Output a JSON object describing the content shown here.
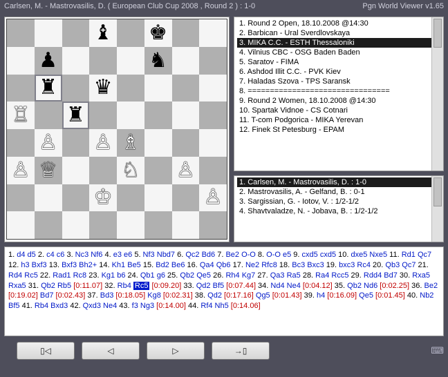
{
  "title_left": "Carlsen, M. - Mastrovasilis, D. ( European Club Cup 2008 , Round 2 ) : 1-0",
  "title_right": "Pgn World Viewer v1.65",
  "board": {
    "dim": 8,
    "highlight": [
      "b6",
      "c5"
    ],
    "pieces": [
      {
        "sq": "d8",
        "p": "bishop",
        "c": "black"
      },
      {
        "sq": "f8",
        "p": "king",
        "c": "black"
      },
      {
        "sq": "b7",
        "p": "pawn",
        "c": "black"
      },
      {
        "sq": "f7",
        "p": "knight",
        "c": "black"
      },
      {
        "sq": "b6",
        "p": "rook",
        "c": "black"
      },
      {
        "sq": "d6",
        "p": "queen",
        "c": "black"
      },
      {
        "sq": "a5",
        "p": "rook",
        "c": "white"
      },
      {
        "sq": "c5",
        "p": "rook",
        "c": "black"
      },
      {
        "sq": "b4",
        "p": "pawn",
        "c": "white"
      },
      {
        "sq": "d4",
        "p": "pawn",
        "c": "white"
      },
      {
        "sq": "e4",
        "p": "bishop",
        "c": "white"
      },
      {
        "sq": "a3",
        "p": "pawn",
        "c": "white"
      },
      {
        "sq": "b3",
        "p": "queen",
        "c": "white"
      },
      {
        "sq": "e3",
        "p": "knight",
        "c": "white"
      },
      {
        "sq": "g3",
        "p": "pawn",
        "c": "white"
      },
      {
        "sq": "d2",
        "p": "king",
        "c": "white"
      },
      {
        "sq": "h2",
        "p": "pawn",
        "c": "white"
      }
    ]
  },
  "rounds": {
    "selected_index": 2,
    "items": [
      "1. Round 2 Open,  18.10.2008 @14:30",
      "2. Barbican - Ural Sverdlovskaya",
      "3. MIKA C.C. - ESTH Thessaloniki",
      "4. Vilnius CBC - OSG Baden Baden",
      "5. Saratov - FIMA",
      "6. Ashdod Illit C.C. - PVK Kiev",
      "7. Haladas Szova - TPS Saransk",
      "8. ================================",
      "9. Round 2 Women, 18.10.2008 @14:30",
      "10. Spartak Vidnoe - CS Cotnari",
      "11. T-com Podgorica - MIKA Yerevan",
      "12. Finek St Petesburg - EPAM"
    ]
  },
  "games": {
    "selected_index": 0,
    "items": [
      "1. Carlsen, M. - Mastrovasilis, D. : 1-0",
      "2. Mastrovasilis, A. - Gelfand, B. : 0-1",
      "3. Sargissian, G. - Iotov, V. : 1/2-1/2",
      "4. Shavtvaladze, N. - Jobava, B. : 1/2-1/2"
    ]
  },
  "moves_tokens": [
    {
      "t": "1.",
      "k": "num"
    },
    {
      "t": " d4",
      "k": "mv"
    },
    {
      "t": " d5",
      "k": "mv"
    },
    {
      "t": " 2.",
      "k": "num"
    },
    {
      "t": " c4",
      "k": "mv"
    },
    {
      "t": " c6",
      "k": "mv"
    },
    {
      "t": " 3.",
      "k": "num"
    },
    {
      "t": " Nc3",
      "k": "mv"
    },
    {
      "t": " Nf6",
      "k": "mv"
    },
    {
      "t": " 4.",
      "k": "num"
    },
    {
      "t": " e3",
      "k": "mv"
    },
    {
      "t": " e6",
      "k": "mv"
    },
    {
      "t": " 5.",
      "k": "num"
    },
    {
      "t": " Nf3",
      "k": "mv"
    },
    {
      "t": " Nbd7",
      "k": "mv"
    },
    {
      "t": " 6.",
      "k": "num"
    },
    {
      "t": " Qc2",
      "k": "mv"
    },
    {
      "t": " Bd6",
      "k": "mv"
    },
    {
      "t": " 7.",
      "k": "num"
    },
    {
      "t": " Be2",
      "k": "mv"
    },
    {
      "t": " O-O",
      "k": "mv"
    },
    {
      "t": " 8.",
      "k": "num"
    },
    {
      "t": " O-O",
      "k": "mv"
    },
    {
      "t": " e5",
      "k": "mv"
    },
    {
      "t": " 9.",
      "k": "num"
    },
    {
      "t": " cxd5",
      "k": "mv"
    },
    {
      "t": " cxd5",
      "k": "mv"
    },
    {
      "t": " 10.",
      "k": "num"
    },
    {
      "t": " dxe5",
      "k": "mv"
    },
    {
      "t": " Nxe5",
      "k": "mv"
    },
    {
      "t": " 11.",
      "k": "num"
    },
    {
      "t": " Rd1",
      "k": "mv"
    },
    {
      "t": " Qc7",
      "k": "mv"
    },
    {
      "t": " 12.",
      "k": "num"
    },
    {
      "t": " h3",
      "k": "mv"
    },
    {
      "t": " Bxf3",
      "k": "mv"
    },
    {
      "t": " 13.",
      "k": "num"
    },
    {
      "t": " Bxf3",
      "k": "mv"
    },
    {
      "t": " Bh2+",
      "k": "mv"
    },
    {
      "t": " 14.",
      "k": "num"
    },
    {
      "t": " Kh1",
      "k": "mv"
    },
    {
      "t": " Be5",
      "k": "mv"
    },
    {
      "t": " 15.",
      "k": "num"
    },
    {
      "t": " Bd2",
      "k": "mv"
    },
    {
      "t": " Be6",
      "k": "mv"
    },
    {
      "t": " 16.",
      "k": "num"
    },
    {
      "t": " Qa4",
      "k": "mv"
    },
    {
      "t": " Qb6",
      "k": "mv"
    },
    {
      "t": " 17.",
      "k": "num"
    },
    {
      "t": " Ne2",
      "k": "mv"
    },
    {
      "t": " Rfc8",
      "k": "mv"
    },
    {
      "t": " 18.",
      "k": "num"
    },
    {
      "t": " Bc3",
      "k": "mv"
    },
    {
      "t": " Bxc3",
      "k": "mv"
    },
    {
      "t": " 19.",
      "k": "num"
    },
    {
      "t": " bxc3",
      "k": "mv"
    },
    {
      "t": " Rc4",
      "k": "mv"
    },
    {
      "t": " 20.",
      "k": "num"
    },
    {
      "t": " Qb3",
      "k": "mv"
    },
    {
      "t": " Qc7",
      "k": "mv"
    },
    {
      "t": " 21.",
      "k": "num"
    },
    {
      "t": " Rd4",
      "k": "mv"
    },
    {
      "t": " Rc5",
      "k": "mv"
    },
    {
      "t": " 22.",
      "k": "num"
    },
    {
      "t": " Rad1",
      "k": "mv"
    },
    {
      "t": " Rc8",
      "k": "mv"
    },
    {
      "t": " 23.",
      "k": "num"
    },
    {
      "t": " Kg1",
      "k": "mv"
    },
    {
      "t": " b6",
      "k": "mv"
    },
    {
      "t": " 24.",
      "k": "num"
    },
    {
      "t": " Qb1",
      "k": "mv"
    },
    {
      "t": " g6",
      "k": "mv"
    },
    {
      "t": " 25.",
      "k": "num"
    },
    {
      "t": " Qb2",
      "k": "mv"
    },
    {
      "t": " Qe5",
      "k": "mv"
    },
    {
      "t": " 26.",
      "k": "num"
    },
    {
      "t": " Rh4",
      "k": "mv"
    },
    {
      "t": " Kg7",
      "k": "mv"
    },
    {
      "t": " 27.",
      "k": "num"
    },
    {
      "t": " Qa3",
      "k": "mv"
    },
    {
      "t": " Ra5",
      "k": "mv"
    },
    {
      "t": " 28.",
      "k": "num"
    },
    {
      "t": " Ra4",
      "k": "mv"
    },
    {
      "t": " Rcc5",
      "k": "mv"
    },
    {
      "t": " 29.",
      "k": "num"
    },
    {
      "t": " Rdd4",
      "k": "mv"
    },
    {
      "t": " Bd7",
      "k": "mv"
    },
    {
      "t": " 30.",
      "k": "num"
    },
    {
      "t": " Rxa5",
      "k": "mv"
    },
    {
      "t": " Rxa5",
      "k": "mv"
    },
    {
      "t": " 31.",
      "k": "num"
    },
    {
      "t": " Qb2",
      "k": "mv"
    },
    {
      "t": " Rb5",
      "k": "mv"
    },
    {
      "t": " [0:11.07]",
      "k": "an"
    },
    {
      "t": " 32.",
      "k": "num"
    },
    {
      "t": " Rb4",
      "k": "mv"
    },
    {
      "t": " ",
      "k": "num"
    },
    {
      "t": "Rc5",
      "k": "cur"
    },
    {
      "t": " [0:09.20]",
      "k": "an"
    },
    {
      "t": " 33.",
      "k": "num"
    },
    {
      "t": " Qd2",
      "k": "mv"
    },
    {
      "t": " Bf5",
      "k": "mv"
    },
    {
      "t": " [0:07.44]",
      "k": "an"
    },
    {
      "t": " 34.",
      "k": "num"
    },
    {
      "t": " Nd4",
      "k": "mv"
    },
    {
      "t": " Ne4",
      "k": "mv"
    },
    {
      "t": " [0:04.12]",
      "k": "an"
    },
    {
      "t": " 35.",
      "k": "num"
    },
    {
      "t": " Qb2",
      "k": "mv"
    },
    {
      "t": " Nd6",
      "k": "mv"
    },
    {
      "t": " [0:02.25]",
      "k": "an"
    },
    {
      "t": " 36.",
      "k": "num"
    },
    {
      "t": " Be2",
      "k": "mv"
    },
    {
      "t": " [0:19.02]",
      "k": "an"
    },
    {
      "t": " Bd7",
      "k": "mv"
    },
    {
      "t": " [0:02.43]",
      "k": "an"
    },
    {
      "t": " 37.",
      "k": "num"
    },
    {
      "t": " Bd3",
      "k": "mv"
    },
    {
      "t": " [0:18.05]",
      "k": "an"
    },
    {
      "t": " Kg8",
      "k": "mv"
    },
    {
      "t": " [0:02.31]",
      "k": "an"
    },
    {
      "t": " 38.",
      "k": "num"
    },
    {
      "t": " Qd2",
      "k": "mv"
    },
    {
      "t": " [0:17.16]",
      "k": "an"
    },
    {
      "t": " Qg5",
      "k": "mv"
    },
    {
      "t": " [0:01.43]",
      "k": "an"
    },
    {
      "t": " 39.",
      "k": "num"
    },
    {
      "t": " h4",
      "k": "mv"
    },
    {
      "t": " [0:16.09]",
      "k": "an"
    },
    {
      "t": " Qe5",
      "k": "mv"
    },
    {
      "t": " [0:01.45]",
      "k": "an"
    },
    {
      "t": " 40.",
      "k": "num"
    },
    {
      "t": " Nb2",
      "k": "mv"
    },
    {
      "t": " Bf5",
      "k": "mv"
    },
    {
      "t": " 41.",
      "k": "num"
    },
    {
      "t": " Rb4",
      "k": "mv"
    },
    {
      "t": " Bxd3",
      "k": "mv"
    },
    {
      "t": " 42.",
      "k": "num"
    },
    {
      "t": " Qxd3",
      "k": "mv"
    },
    {
      "t": " Ne4",
      "k": "mv"
    },
    {
      "t": " 43.",
      "k": "num"
    },
    {
      "t": " f3",
      "k": "mv"
    },
    {
      "t": " Ng3",
      "k": "mv"
    },
    {
      "t": " [0:14.00]",
      "k": "an"
    },
    {
      "t": " 44.",
      "k": "num"
    },
    {
      "t": " Rf4",
      "k": "mv"
    },
    {
      "t": " Nh5",
      "k": "mv"
    },
    {
      "t": " [0:14.06]",
      "k": "an"
    }
  ],
  "buttons": {
    "first": "▯◁",
    "prev": "◁",
    "next": "▷",
    "last": "→▯"
  }
}
